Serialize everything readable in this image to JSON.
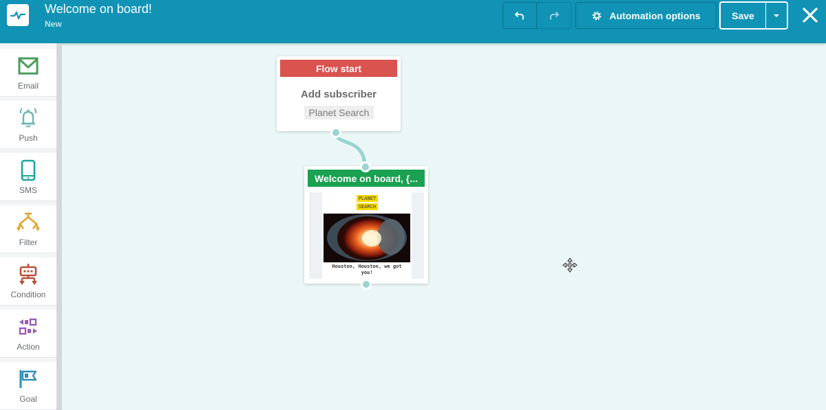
{
  "header": {
    "title": "Welcome on board!",
    "subtitle": "New",
    "automation_options_label": "Automation options",
    "save_label": "Save",
    "brand_color": "#1093b5"
  },
  "sidebar": {
    "items": [
      {
        "label": "Email",
        "icon": "email-icon",
        "color": "#4a9c5b"
      },
      {
        "label": "Push",
        "icon": "bell-icon",
        "color": "#6fb5ad"
      },
      {
        "label": "SMS",
        "icon": "phone-icon",
        "color": "#1aa5a0"
      },
      {
        "label": "Filter",
        "icon": "filter-icon",
        "color": "#e3a32c"
      },
      {
        "label": "Condition",
        "icon": "condition-icon",
        "color": "#b7513a"
      },
      {
        "label": "Action",
        "icon": "action-icon",
        "color": "#9a5bb5"
      },
      {
        "label": "Goal",
        "icon": "flag-icon",
        "color": "#2d8fba"
      }
    ]
  },
  "flow": {
    "start_node": {
      "header": "Flow start",
      "action": "Add subscriber",
      "list_tag": "Planet Search",
      "header_color": "#d9534f"
    },
    "email_node": {
      "header": "Welcome on board, {...",
      "header_color": "#1aa152",
      "preview_brand_line1": "PLANET",
      "preview_brand_line2": "SEARCH",
      "preview_caption": "Houston, Houston, we got you!"
    }
  }
}
